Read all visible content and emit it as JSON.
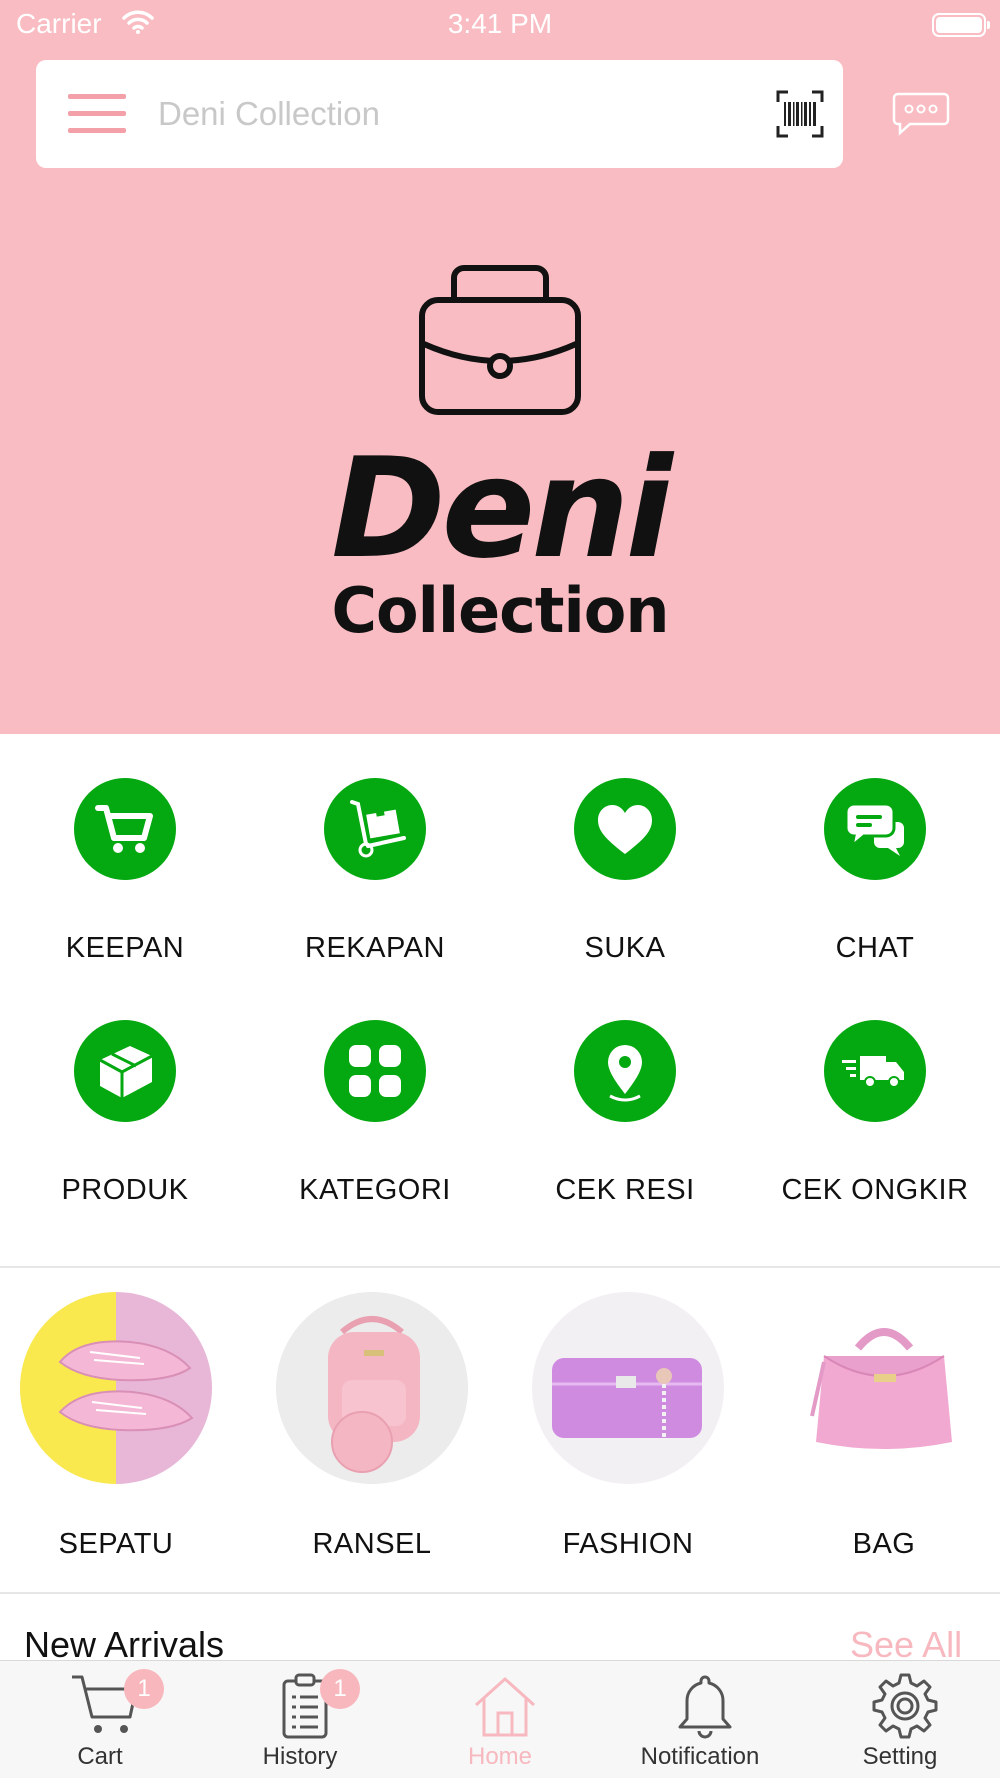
{
  "status_bar": {
    "carrier": "Carrier",
    "time": "3:41 PM"
  },
  "search": {
    "placeholder": "Deni Collection"
  },
  "logo": {
    "title": "Deni",
    "subtitle": "Collection"
  },
  "features": [
    {
      "label": "KEEPAN",
      "icon": "cart-icon"
    },
    {
      "label": "REKAPAN",
      "icon": "hand-truck-icon"
    },
    {
      "label": "SUKA",
      "icon": "heart-icon"
    },
    {
      "label": "CHAT",
      "icon": "chat-icon"
    },
    {
      "label": "PRODUK",
      "icon": "box-icon"
    },
    {
      "label": "KATEGORI",
      "icon": "grid-icon"
    },
    {
      "label": "CEK RESI",
      "icon": "location-pin-icon"
    },
    {
      "label": "CEK ONGKIR",
      "icon": "delivery-truck-icon"
    }
  ],
  "categories": [
    {
      "label": "SEPATU"
    },
    {
      "label": "RANSEL"
    },
    {
      "label": "FASHION"
    },
    {
      "label": "BAG"
    }
  ],
  "section": {
    "title": "New Arrivals",
    "see_all": "See All"
  },
  "tabbar": [
    {
      "label": "Cart",
      "icon": "cart-icon",
      "badge": "1"
    },
    {
      "label": "History",
      "icon": "clipboard-icon",
      "badge": "1"
    },
    {
      "label": "Home",
      "icon": "home-icon",
      "active": true
    },
    {
      "label": "Notification",
      "icon": "bell-icon"
    },
    {
      "label": "Setting",
      "icon": "gear-icon"
    }
  ],
  "colors": {
    "brand_pink": "#f9bcc2",
    "accent_green": "#04a810",
    "active_tab": "#f7b8bf"
  }
}
